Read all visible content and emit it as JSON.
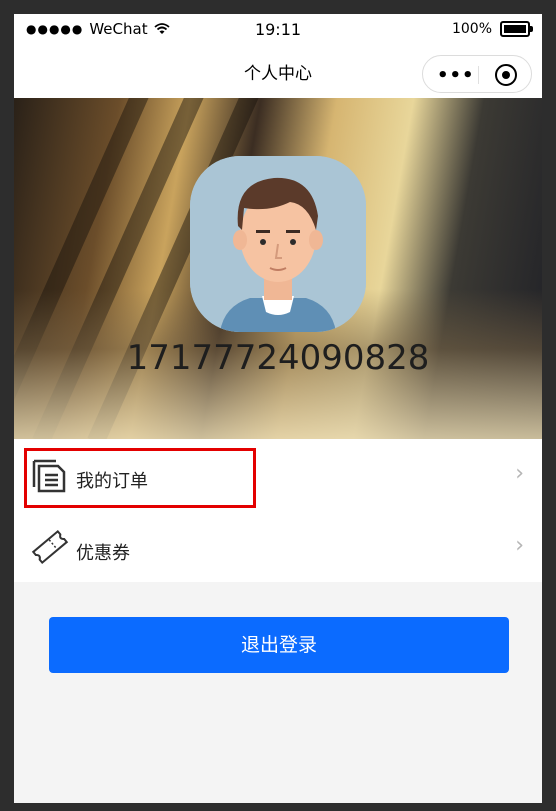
{
  "status_bar": {
    "carrier": "WeChat",
    "time": "19:11",
    "battery_percent": "100%",
    "battery_level": 1.0
  },
  "nav": {
    "title": "个人中心"
  },
  "profile": {
    "phone": "17177724090828"
  },
  "menu": {
    "items": [
      {
        "label": "我的订单",
        "icon": "order-list-icon"
      },
      {
        "label": "优惠券",
        "icon": "coupon-ticket-icon"
      }
    ]
  },
  "actions": {
    "logout_label": "退出登录"
  },
  "colors": {
    "primary": "#0b6bff",
    "highlight": "#e30000"
  }
}
